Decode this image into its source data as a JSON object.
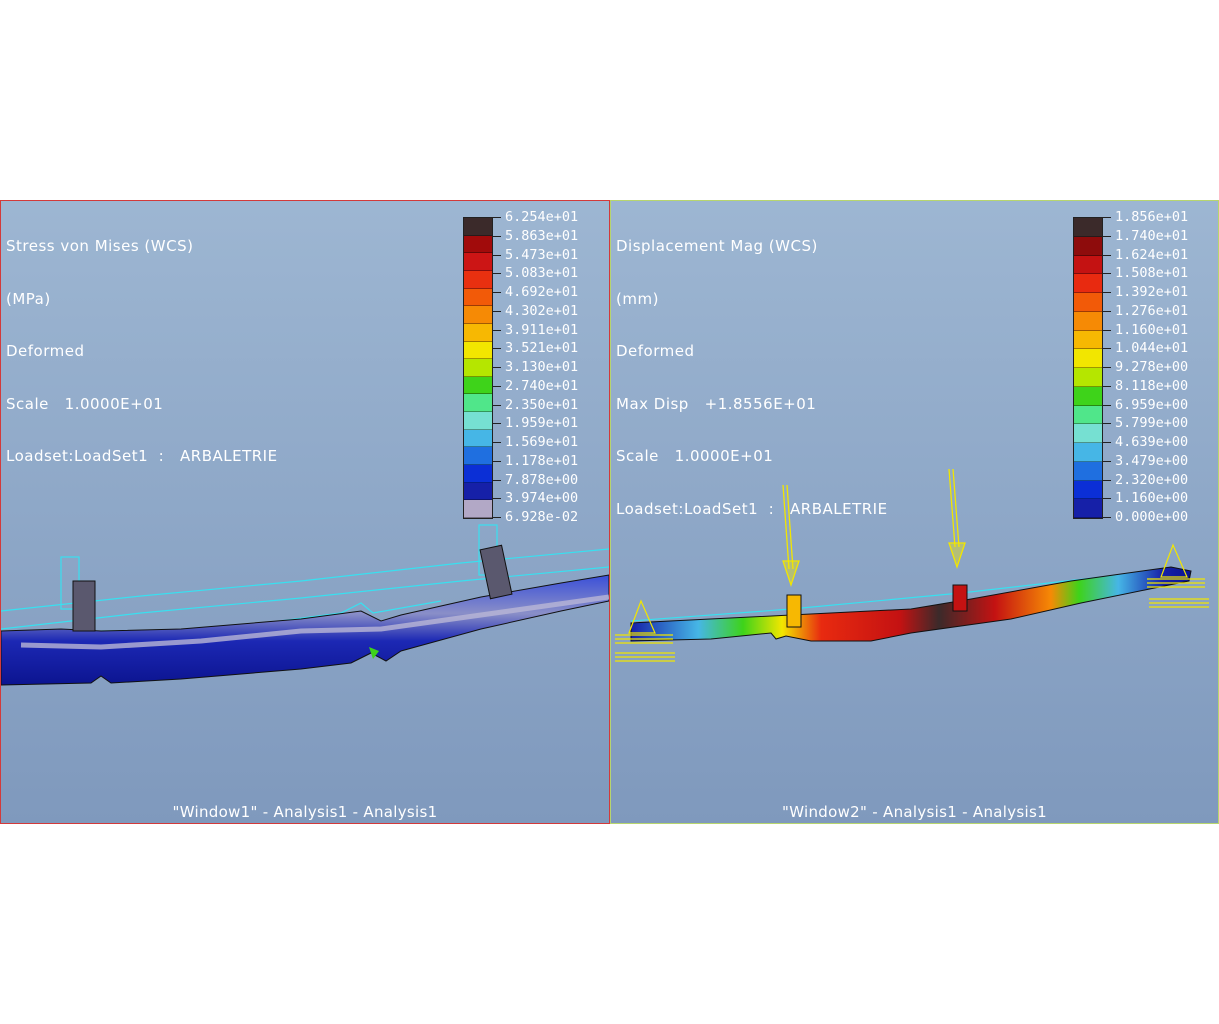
{
  "windows": [
    {
      "id": "window1",
      "header": [
        "Stress von Mises (WCS)",
        "(MPa)",
        "Deformed",
        "Scale   1.0000E+01",
        "Loadset:LoadSet1  :   ARBALETRIE"
      ],
      "footer": "\"Window1\"  -  Analysis1  -  Analysis1",
      "legend_values": [
        "6.254e+01",
        "5.863e+01",
        "5.473e+01",
        "5.083e+01",
        "4.692e+01",
        "4.302e+01",
        "3.911e+01",
        "3.521e+01",
        "3.130e+01",
        "2.740e+01",
        "2.350e+01",
        "1.959e+01",
        "1.569e+01",
        "1.178e+01",
        "7.878e+00",
        "3.974e+00",
        "6.928e-02"
      ],
      "legend_colors": [
        "#3b2a2a",
        "#a10b0b",
        "#cc1515",
        "#e83010",
        "#f25a08",
        "#f68a05",
        "#f7b802",
        "#f2e600",
        "#b5e600",
        "#3ed31a",
        "#50e68a",
        "#76e0d2",
        "#46b6e6",
        "#1f6fe0",
        "#0b2fd6",
        "#1620a8",
        "#b2a8c6"
      ],
      "border_color": "#d33a3a"
    },
    {
      "id": "window2",
      "header": [
        "Displacement Mag (WCS)",
        "(mm)",
        "Deformed",
        "Max Disp   +1.8556E+01",
        "Scale   1.0000E+01",
        "Loadset:LoadSet1  :   ARBALETRIE"
      ],
      "footer": "\"Window2\"  -  Analysis1  -  Analysis1",
      "legend_values": [
        "1.856e+01",
        "1.740e+01",
        "1.624e+01",
        "1.508e+01",
        "1.392e+01",
        "1.276e+01",
        "1.160e+01",
        "1.044e+01",
        "9.278e+00",
        "8.118e+00",
        "6.959e+00",
        "5.799e+00",
        "4.639e+00",
        "3.479e+00",
        "2.320e+00",
        "1.160e+00",
        "0.000e+00"
      ],
      "legend_colors": [
        "#3b2a2a",
        "#8e0c0c",
        "#c41212",
        "#e82a10",
        "#f25a08",
        "#f68a05",
        "#f7b802",
        "#f2e600",
        "#b5e600",
        "#3ed31a",
        "#50e68a",
        "#76e0d2",
        "#46b6e6",
        "#1f6fe0",
        "#0b2fd6",
        "#1620a8"
      ],
      "border_color": "#b7d56e"
    }
  ]
}
